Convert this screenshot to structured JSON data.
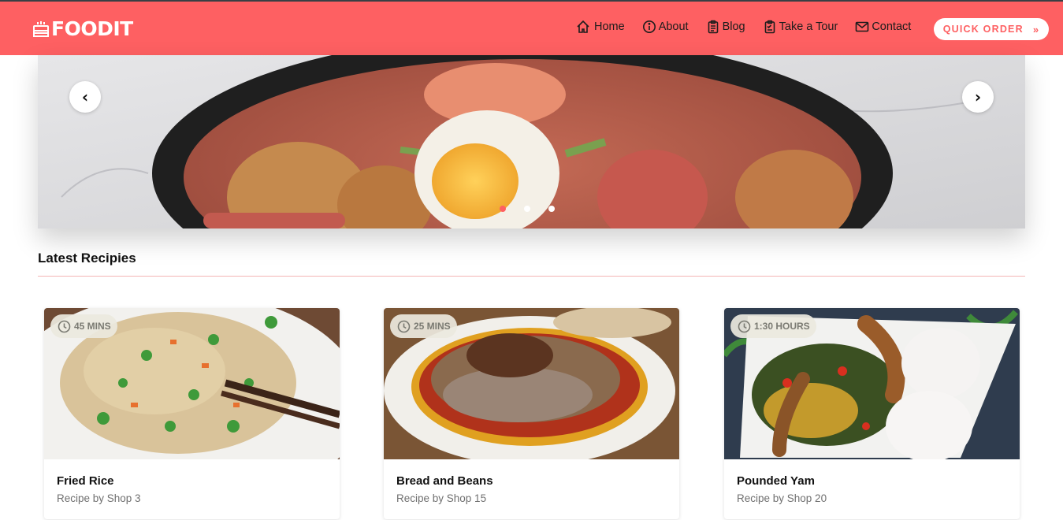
{
  "brand": {
    "name": "FOODIT",
    "icon": "cake-icon"
  },
  "nav": {
    "items": [
      {
        "label": "Home",
        "icon": "home-icon"
      },
      {
        "label": "About",
        "icon": "info-icon"
      },
      {
        "label": "Blog",
        "icon": "clipboard-icon"
      },
      {
        "label": "Take a Tour",
        "icon": "clipboard-list-icon"
      },
      {
        "label": "Contact",
        "icon": "envelope-icon"
      }
    ],
    "cta": {
      "label": "QUICK ORDER",
      "arrow": "»"
    }
  },
  "carousel": {
    "prev": "‹",
    "next": "›",
    "slide_count": 3,
    "active_slide": 1
  },
  "section": {
    "title": "Latest Recipies"
  },
  "recipes": [
    {
      "time": "45 MINS",
      "title": "Fried Rice",
      "subtitle": "Recipe by Shop 3"
    },
    {
      "time": "25 MINS",
      "title": "Bread and Beans",
      "subtitle": "Recipe by Shop 15"
    },
    {
      "time": "1:30 HOURS",
      "title": "Pounded Yam",
      "subtitle": "Recipe by Shop 20"
    }
  ],
  "colors": {
    "brand": "#fe6062",
    "accent_rule": "#f5b5b6"
  }
}
